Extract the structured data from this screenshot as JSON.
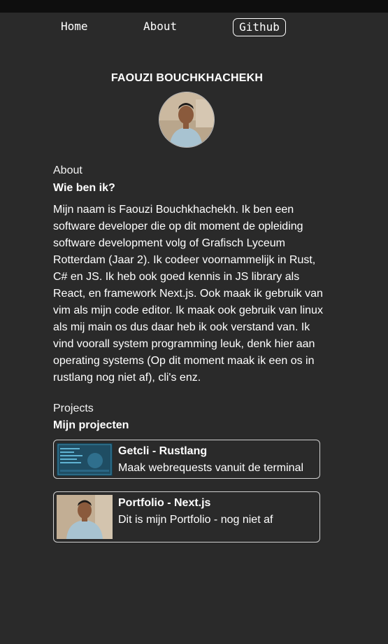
{
  "nav": {
    "home": "Home",
    "about": "About",
    "github": "Github"
  },
  "profile": {
    "name": "FAOUZI BOUCHKHACHEKH"
  },
  "about": {
    "label": "About",
    "title": "Wie ben ik?",
    "text": "Mijn naam is Faouzi Bouchkhachekh. Ik ben een software developer die op dit moment de opleiding software development volg of Grafisch Lyceum Rotterdam (Jaar 2). Ik codeer voornammelijk in Rust, C# en JS. Ik heb ook goed kennis in JS library als React, en framework Next.js. Ook maak ik gebruik van vim als mijn code editor. Ik maak ook gebruik van linux als mij main os dus daar heb ik ook verstand van. Ik vind voorall system programming leuk, denk hier aan operating systems (Op dit moment maak ik een os in rustlang nog niet af), cli's enz."
  },
  "projects": {
    "label": "Projects",
    "title": "Mijn projecten",
    "items": [
      {
        "title": "Getcli - Rustlang",
        "description": "Maak webrequests vanuit de terminal"
      },
      {
        "title": "Portfolio - Next.js",
        "description": "Dit is mijn Portfolio - nog niet af"
      }
    ]
  },
  "colors": {
    "background": "#2a2a2a",
    "text": "#ffffff",
    "border": "#cfcfcf"
  }
}
